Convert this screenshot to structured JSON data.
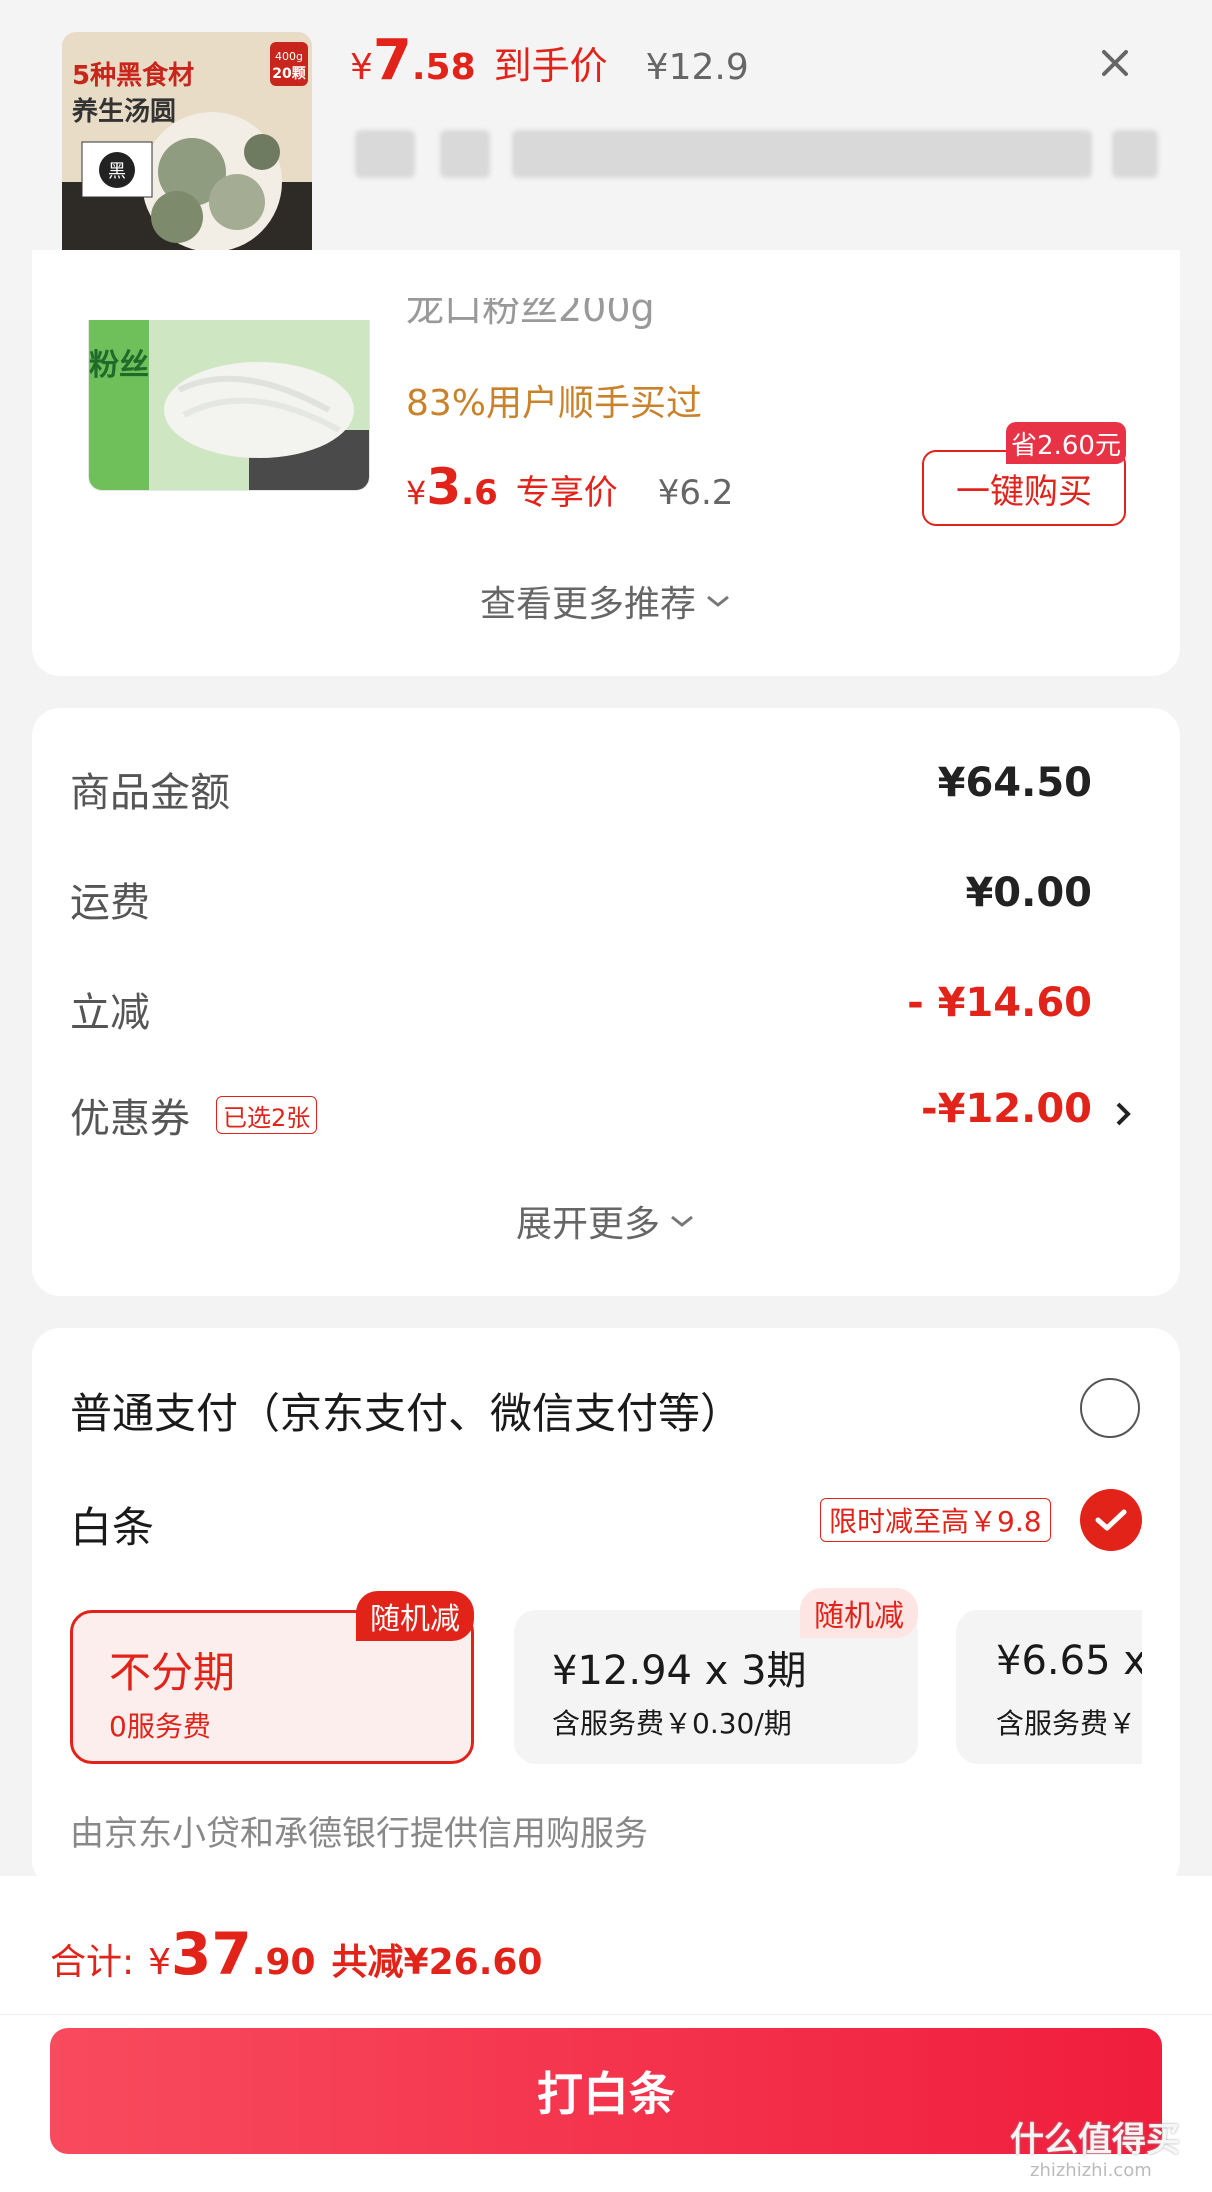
{
  "top_product": {
    "currency": "¥",
    "price_int": "7",
    "price_dec": ".58",
    "price_label": "到手价",
    "original_price": "¥12.9",
    "image_caption_line1": "5种黑食材",
    "image_caption_line2": "养生汤圆",
    "image_badge_weight": "400g",
    "image_badge_count": "20颗",
    "image_pack_char": "黑"
  },
  "recommendation": {
    "title_partial": "龙口粉丝200g",
    "image_text": "粉丝",
    "buy_stat": "83%用户顺手买过",
    "currency": "¥",
    "price_int": "3",
    "price_dec": ".6",
    "price_label": "专享价",
    "original_price": "¥6.2",
    "save_badge": "省2.60元",
    "buy_button": "一键购买",
    "more_link": "查看更多推荐"
  },
  "summary": {
    "rows": [
      {
        "label": "商品金额",
        "value": "¥64.50"
      },
      {
        "label": "运费",
        "value": "¥0.00"
      },
      {
        "label": "立减",
        "value": "- ¥14.60"
      },
      {
        "label": "优惠券",
        "value": "-¥12.00",
        "tag": "已选2张"
      }
    ],
    "expand_link": "展开更多"
  },
  "payment": {
    "normal_label": "普通支付（京东支付、微信支付等）",
    "baitiao_label": "白条",
    "promo_tag": "限时减至高￥9.8",
    "plans": [
      {
        "title": "不分期",
        "subtitle": "0服务费",
        "tag": "随机减"
      },
      {
        "title": "¥12.94 x 3期",
        "subtitle": "含服务费￥0.30/期",
        "tag": "随机减"
      },
      {
        "title": "¥6.65 x",
        "subtitle": "含服务费￥"
      }
    ],
    "provider_note": "由京东小贷和承德银行提供信用购服务"
  },
  "footer": {
    "total_label": "合计:",
    "currency": "¥",
    "total_int": "37",
    "total_dec": ".90",
    "saved": "共减¥26.60",
    "pay_button": "打白条",
    "watermark": "什么值得买",
    "watermark_url": "zhizhizhi.com"
  },
  "colors": {
    "accent": "#e2231a",
    "orange": "#c9822b",
    "pay_button": "#f01d3c"
  }
}
